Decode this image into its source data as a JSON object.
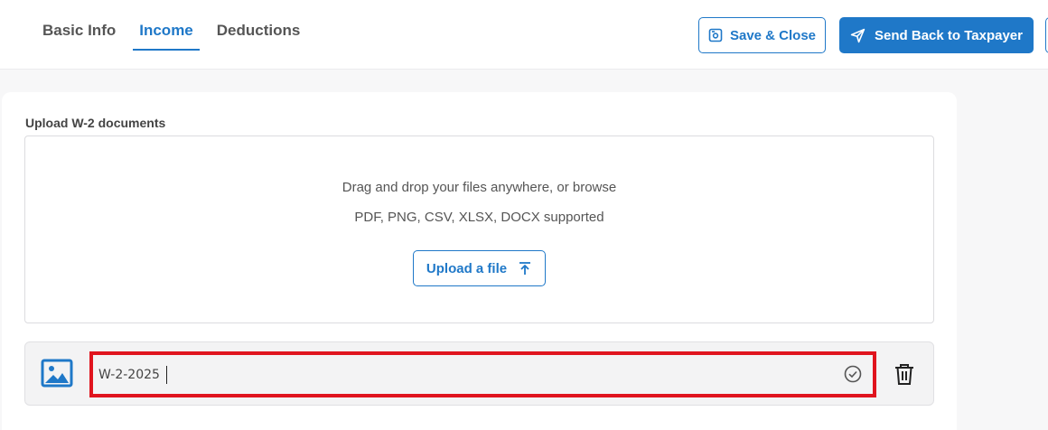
{
  "tabs": [
    {
      "label": "Basic Info",
      "active": false
    },
    {
      "label": "Income",
      "active": true
    },
    {
      "label": "Deductions",
      "active": false
    }
  ],
  "header": {
    "save_close_label": "Save & Close",
    "save_close_icon": "save-icon",
    "send_back_label": "Send Back to Taxpayer",
    "send_back_icon": "send-icon"
  },
  "upload": {
    "section_label": "Upload W-2 documents",
    "drop_text": "Drag and drop your files anywhere, or browse",
    "supported_text": "PDF, PNG, CSV, XLSX, DOCX supported",
    "upload_button_label": "Upload a file",
    "upload_icon": "upload-arrow-icon"
  },
  "file": {
    "icon": "image-file-icon",
    "name_value": "W-2-2025",
    "status_icon": "check-circle-icon",
    "delete_icon": "trash-icon"
  },
  "colors": {
    "accent": "#1f78c8",
    "highlight": "#e0141e",
    "background": "#f7f7f8"
  }
}
